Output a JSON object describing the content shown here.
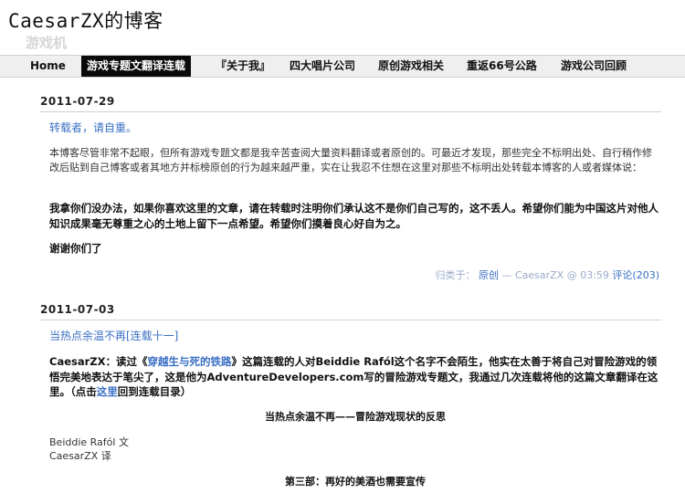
{
  "blog": {
    "title": "CaesarZX的博客",
    "watermark": "游戏机"
  },
  "nav": {
    "items": [
      {
        "label": "Home"
      },
      {
        "label": "游戏专题文翻译连载"
      },
      {
        "label": "『关于我』"
      },
      {
        "label": "四大唱片公司"
      },
      {
        "label": "原创游戏相关"
      },
      {
        "label": "重返66号公路"
      },
      {
        "label": "游戏公司回顾"
      }
    ]
  },
  "post1": {
    "date": "2011-07-29",
    "title": "转载者，请自重。",
    "para1": "本博客尽管非常不起眼，但所有游戏专题文都是我辛苦查阅大量资料翻译或者原创的。可最近才发现，那些完全不标明出处、自行稍作修改后贴到自己博客或者其地方并标榜原创的行为越来越严重，实在让我忍不住想在这里对那些不标明出处转载本博客的人或者媒体说：",
    "para2": "我拿你们没办法，如果你喜欢这里的文章，请在转载时注明你们承认这不是你们自己写的，这不丢人。希望你们能为中国这片对他人知识成果毫无尊重之心的土地上留下一点希望。希望你们摸着良心好自为之。",
    "para3": "谢谢你们了",
    "meta_prefix": "归类于：",
    "category": "原创",
    "meta_mid": " — CaesarZX @ 03:59 ",
    "comments": "评论(203)"
  },
  "post2": {
    "date": "2011-07-03",
    "title": "当热点余温不再[连载十一]",
    "intro_a": "CaesarZX：读过《",
    "intro_link": "穿越生与死的铁路",
    "intro_b": "》这篇连载的人对Beiddie Rafól这个名字不会陌生，他实在太善于将自己对冒险游戏的领悟完美地表达于笔尖了，这是他为AdventureDevelopers.com写的冒险游戏专题文，我通过几次连载将他的这篇文章翻译在这里。（点击",
    "intro_here": "这里",
    "intro_c": "回到连载目录）",
    "subtitle": "当热点余温不再——冒险游戏现状的反思",
    "author_line": "Beiddie Rafól 文",
    "translator_line": "CaesarZX 译",
    "part_title": "第三部：再好的美酒也需要宣传"
  }
}
